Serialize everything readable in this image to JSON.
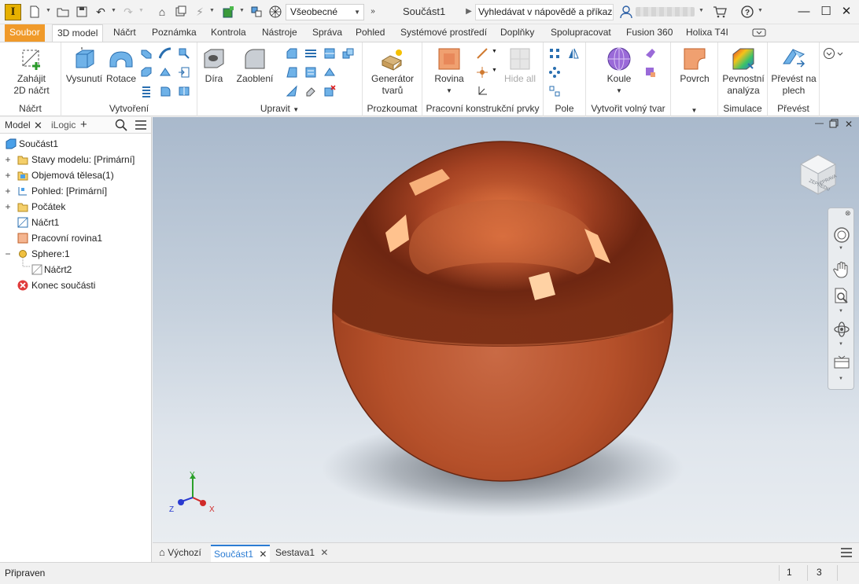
{
  "titlebar": {
    "app_logo": "I",
    "style_combo": "Všeobecné",
    "document_title": "Součást1",
    "search_placeholder": "Vyhledávat v nápovědě a příkaze"
  },
  "tabs": [
    {
      "label": "Soubor"
    },
    {
      "label": "3D model"
    },
    {
      "label": "Náčrt"
    },
    {
      "label": "Poznámka"
    },
    {
      "label": "Kontrola"
    },
    {
      "label": "Nástroje"
    },
    {
      "label": "Správa"
    },
    {
      "label": "Pohled"
    },
    {
      "label": "Systémové prostředí"
    },
    {
      "label": "Doplňky"
    },
    {
      "label": "Spolupracovat"
    },
    {
      "label": "Fusion 360"
    },
    {
      "label": "Holixa T4I"
    }
  ],
  "ribbon": {
    "sketch": {
      "start_2d_line1": "Zahájit",
      "start_2d_line2": "2D náčrt",
      "title": "Náčrt"
    },
    "create": {
      "extrude": "Vysunutí",
      "revolve": "Rotace",
      "title": "Vytvoření"
    },
    "modify": {
      "hole": "Díra",
      "fillet": "Zaoblení",
      "title": "Upravit"
    },
    "explore": {
      "generator_line1": "Generátor",
      "generator_line2": "tvarů",
      "title": "Prozkoumat"
    },
    "work_features": {
      "plane": "Rovina",
      "hide_all": "Hide all",
      "title": "Pracovní konstrukční prvky"
    },
    "pattern": {
      "title": "Pole"
    },
    "freeform": {
      "sphere": "Koule",
      "title": "Vytvořit volný tvar"
    },
    "surface": {
      "label": "Povrch"
    },
    "simulation": {
      "stress_line1": "Pevnostní",
      "stress_line2": "analýza",
      "title": "Simulace"
    },
    "convert": {
      "sheet_line1": "Převést na",
      "sheet_line2": "plech",
      "title": "Převést"
    }
  },
  "browser": {
    "tabs": [
      "Model",
      "iLogic"
    ],
    "tree": [
      {
        "label": "Součást1",
        "expander": "",
        "icon": "part-icon"
      },
      {
        "label": "Stavy modelu: [Primární]",
        "expander": "+",
        "icon": "folder-icon"
      },
      {
        "label": "Objemová tělesa(1)",
        "expander": "+",
        "icon": "solid-bodies-icon"
      },
      {
        "label": "Pohled: [Primární]",
        "expander": "+",
        "icon": "view-rep-icon"
      },
      {
        "label": "Počátek",
        "expander": "+",
        "icon": "folder-icon"
      },
      {
        "label": "Náčrt1",
        "expander": "",
        "icon": "sketch-icon"
      },
      {
        "label": "Pracovní rovina1",
        "expander": "",
        "icon": "work-plane-icon"
      },
      {
        "label": "Sphere:1",
        "expander": "−",
        "icon": "freeform-sphere-icon"
      },
      {
        "label": "Náčrt2",
        "expander": "",
        "icon": "sketch-icon"
      },
      {
        "label": "Konec součásti",
        "expander": "",
        "icon": "end-of-part-icon"
      }
    ]
  },
  "viewcube": {
    "left_face": "ZEPŘEDU",
    "right_face": "ZPRAVA"
  },
  "triad": {
    "x": "X",
    "y": "Y",
    "z": "Z"
  },
  "doc_tabs": [
    {
      "label": "Výchozí"
    },
    {
      "label": "Součást1"
    },
    {
      "label": "Sestava1"
    }
  ],
  "status": {
    "text": "Připraven",
    "count1": "1",
    "count2": "3"
  },
  "colors": {
    "sphere": "#b5502a",
    "accent": "#f09a2a",
    "active_tab": "#2b7cd3"
  }
}
